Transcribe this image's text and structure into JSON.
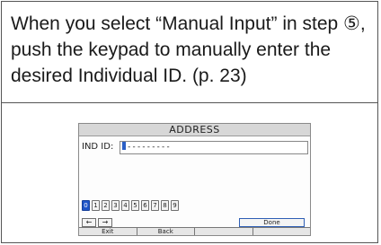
{
  "instruction": {
    "text": "When you select “Manual Input” in step ⑤, push the keypad to manually enter the desired Individual ID. (p. 23)"
  },
  "screen": {
    "title": "ADDRESS",
    "id_label": "IND ID:",
    "id_value": "---------",
    "keypad": [
      "0",
      "1",
      "2",
      "3",
      "4",
      "5",
      "6",
      "7",
      "8",
      "9"
    ],
    "selected_key": "0",
    "left_arrow": "←",
    "right_arrow": "→",
    "done_label": "Done",
    "softkeys": [
      "Exit",
      "Back",
      "",
      ""
    ]
  },
  "colors": {
    "selected_key": "#1f55c8",
    "title_bar": "#d7d7d7"
  }
}
